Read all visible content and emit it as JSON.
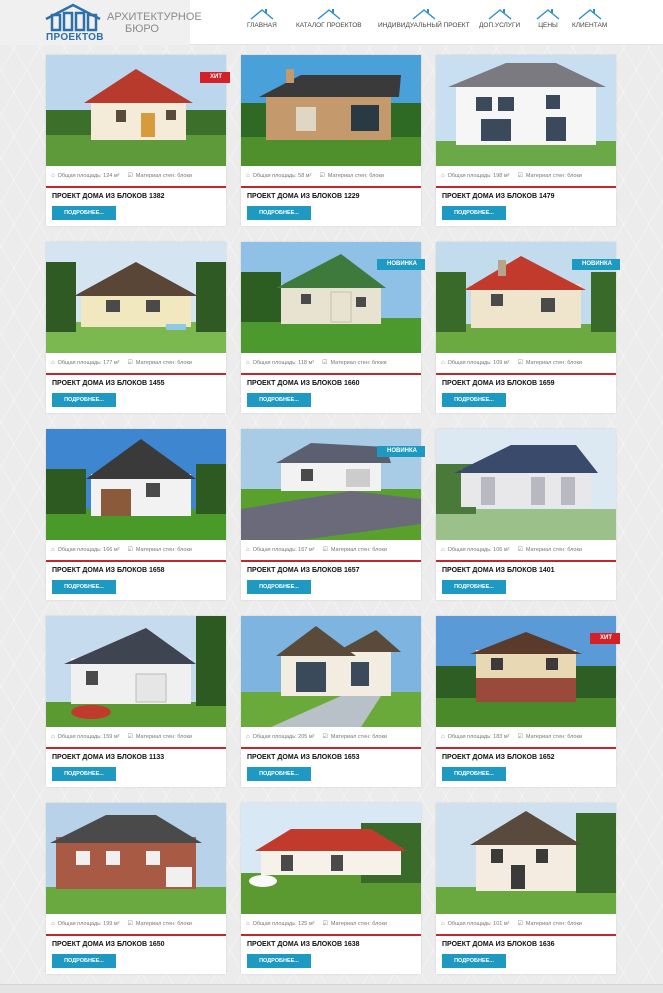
{
  "header": {
    "logo_text": "ПРОЕКТОВ",
    "brand_line1": "АРХИТЕКТУРНОЕ",
    "brand_line2": "БЮРО",
    "nav": [
      {
        "label": "ГЛАВНАЯ",
        "icon": "house-icon"
      },
      {
        "label": "КАТАЛОГ ПРОЕКТОВ",
        "icon": "house-icon"
      },
      {
        "label": "ИНДИВИДУАЛЬНЫЙ ПРОЕКТ",
        "icon": "house-icon"
      },
      {
        "label": "ДОП.УСЛУГИ",
        "icon": "house-icon"
      },
      {
        "label": "ЦЕНЫ",
        "icon": "house-icon"
      },
      {
        "label": "КЛИЕНТАМ",
        "icon": "house-icon"
      }
    ]
  },
  "cards": [
    {
      "title": "ПРОЕКТ ДОМА ИЗ БЛОКОВ 1382",
      "area": "Общая площадь: 124 м²",
      "material": "Материал стен: блоки",
      "badge": "ХИТ",
      "button": "ПОДРОБНЕЕ..."
    },
    {
      "title": "ПРОЕКТ ДОМА ИЗ БЛОКОВ 1229",
      "area": "Общая площадь: 58 м²",
      "material": "Материал стен: блоки",
      "badge": "",
      "button": "ПОДРОБНЕЕ..."
    },
    {
      "title": "ПРОЕКТ ДОМА ИЗ БЛОКОВ 1479",
      "area": "Общая площадь: 198 м²",
      "material": "Материал стен: блоки",
      "badge": "",
      "button": "ПОДРОБНЕЕ..."
    },
    {
      "title": "ПРОЕКТ ДОМА ИЗ БЛОКОВ 1455",
      "area": "Общая площадь: 177 м²",
      "material": "Материал стен: блоки",
      "badge": "",
      "button": "ПОДРОБНЕЕ..."
    },
    {
      "title": "ПРОЕКТ ДОМА ИЗ БЛОКОВ 1660",
      "area": "Общая площадь: 118 м²",
      "material": "Материал стен: блоки",
      "badge": "НОВИНКА",
      "button": "ПОДРОБНЕЕ..."
    },
    {
      "title": "ПРОЕКТ ДОМА ИЗ БЛОКОВ 1659",
      "area": "Общая площадь: 109 м²",
      "material": "Материал стен: блоки",
      "badge": "НОВИНКА",
      "button": "ПОДРОБНЕЕ..."
    },
    {
      "title": "ПРОЕКТ ДОМА ИЗ БЛОКОВ 1658",
      "area": "Общая площадь: 166 м²",
      "material": "Материал стен: блоки",
      "badge": "",
      "button": "ПОДРОБНЕЕ..."
    },
    {
      "title": "ПРОЕКТ ДОМА ИЗ БЛОКОВ 1657",
      "area": "Общая площадь: 167 м²",
      "material": "Материал стен: блоки",
      "badge": "НОВИНКА",
      "button": "ПОДРОБНЕЕ..."
    },
    {
      "title": "ПРОЕКТ ДОМА ИЗ БЛОКОВ 1401",
      "area": "Общая площадь: 106 м²",
      "material": "Материал стен: блоки",
      "badge": "",
      "button": "ПОДРОБНЕЕ..."
    },
    {
      "title": "ПРОЕКТ ДОМА ИЗ БЛОКОВ 1133",
      "area": "Общая площадь: 159 м²",
      "material": "Материал стен: блоки",
      "badge": "",
      "button": "ПОДРОБНЕЕ..."
    },
    {
      "title": "ПРОЕКТ ДОМА ИЗ БЛОКОВ 1653",
      "area": "Общая площадь: 205 м²",
      "material": "Материал стен: блоки",
      "badge": "",
      "button": "ПОДРОБНЕЕ..."
    },
    {
      "title": "ПРОЕКТ ДОМА ИЗ БЛОКОВ 1652",
      "area": "Общая площадь: 183 м²",
      "material": "Материал стен: блоки",
      "badge": "ХИТ",
      "button": "ПОДРОБНЕЕ..."
    },
    {
      "title": "ПРОЕКТ ДОМА ИЗ БЛОКОВ 1650",
      "area": "Общая площадь: 199 м²",
      "material": "Материал стен: блоки",
      "badge": "",
      "button": "ПОДРОБНЕЕ..."
    },
    {
      "title": "ПРОЕКТ ДОМА ИЗ БЛОКОВ 1638",
      "area": "Общая площадь: 125 м²",
      "material": "Материал стен: блоки",
      "badge": "",
      "button": "ПОДРОБНЕЕ..."
    },
    {
      "title": "ПРОЕКТ ДОМА ИЗ БЛОКОВ 1636",
      "area": "Общая площадь: 101 м²",
      "material": "Материал стен: блоки",
      "badge": "",
      "button": "ПОДРОБНЕЕ..."
    }
  ],
  "colors": {
    "accent_blue": "#1e9ac2",
    "hit_red": "#d42027",
    "divider_red": "#c0282d",
    "logo_blue": "#2d6fa8"
  }
}
